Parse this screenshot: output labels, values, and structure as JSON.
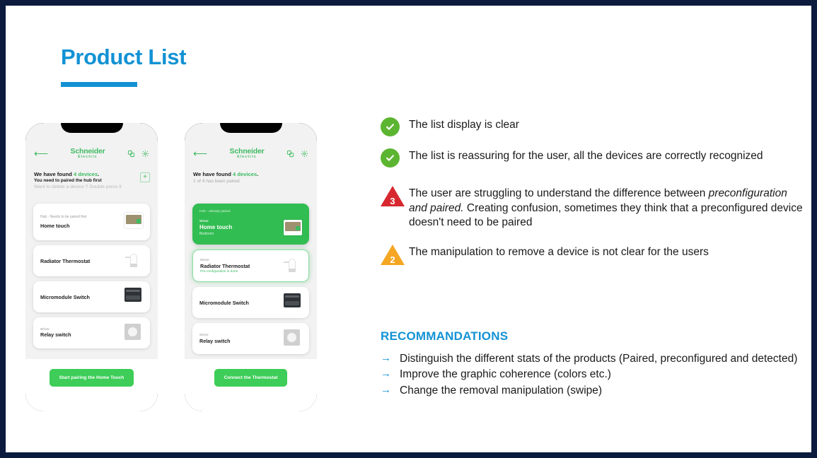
{
  "slide": {
    "title": "Product List",
    "border_color": "#0a1b3d",
    "accent_blue": "#1292d4"
  },
  "phones": [
    {
      "id": "phone-left",
      "app": {
        "back_icon": "back-arrow-icon",
        "logo_main": "Schneider",
        "logo_sub": "Electric",
        "icons": [
          "devices-icon",
          "gear-icon"
        ],
        "add_label": "+"
      },
      "found_prefix": "We have found ",
      "found_count": "4 devices",
      "found_suffix": ".",
      "found_sub": "You need to paired the hub first",
      "found_hint": "Want to delete a device ? Double press it",
      "cards": [
        {
          "status": "Hub - Needs to be paired first",
          "eyebrow": "",
          "name": "Home touch",
          "note": "",
          "room": "",
          "thumb": "home-touch-thumb",
          "state": "default",
          "tall": true
        },
        {
          "status": "",
          "eyebrow": "",
          "name": "Radiator Thermostat",
          "note": "",
          "room": "",
          "thumb": "radiator-valve-thumb",
          "state": "default",
          "tall": false
        },
        {
          "status": "",
          "eyebrow": "",
          "name": "Micromodule Switch",
          "note": "",
          "room": "",
          "thumb": "micromodule-thumb",
          "state": "default",
          "tall": false
        },
        {
          "status": "",
          "eyebrow": "Wiser",
          "name": "Relay switch",
          "note": "",
          "room": "",
          "thumb": "relay-switch-thumb",
          "state": "default",
          "tall": false
        }
      ],
      "cta": "Start pairing the Home Touch"
    },
    {
      "id": "phone-right",
      "app": {
        "back_icon": "back-arrow-icon",
        "logo_main": "Schneider",
        "logo_sub": "Electric",
        "icons": [
          "devices-icon",
          "gear-icon"
        ],
        "add_label": ""
      },
      "found_prefix": "We have found ",
      "found_count": "4 devices",
      "found_suffix": ".",
      "found_sub": "1 of 4 has been paired",
      "found_hint": "",
      "cards": [
        {
          "status": "Hub - already paired",
          "eyebrow": "Wiser",
          "name": "Home touch",
          "note": "",
          "room": "Bedroom",
          "thumb": "home-touch-thumb",
          "state": "paired",
          "tall": true
        },
        {
          "status": "",
          "eyebrow": "Wiser",
          "name": "Radiator Thermostat",
          "note": "Pre-configuration is done",
          "room": "",
          "thumb": "radiator-valve-thumb",
          "state": "preconfigured",
          "tall": false
        },
        {
          "status": "",
          "eyebrow": "",
          "name": "Micromodule Switch",
          "note": "",
          "room": "",
          "thumb": "micromodule-thumb",
          "state": "default",
          "tall": false
        },
        {
          "status": "",
          "eyebrow": "Wiser",
          "name": "Relay switch",
          "note": "",
          "room": "",
          "thumb": "relay-switch-thumb",
          "state": "default",
          "tall": false
        }
      ],
      "cta": "Connect the Thermostat"
    }
  ],
  "findings": [
    {
      "badge": "check",
      "color": "#5cb531",
      "text": "The list display is clear"
    },
    {
      "badge": "check",
      "color": "#5cb531",
      "text": "The list is reassuring for the user, all the devices are correctly recognized"
    },
    {
      "badge": "triangle",
      "number": "3",
      "color": "#d7282f",
      "text_before": "The user are struggling to understand the difference between ",
      "text_italic": "preconfiguration and paired.",
      "text_after": " Creating confusion, sometimes they think that a preconfigured device doesn't need to be paired"
    },
    {
      "badge": "triangle",
      "number": "2",
      "color": "#f5a623",
      "text": "The manipulation to remove a device is not clear for the users"
    }
  ],
  "recommendations": {
    "title": "RECOMMANDATIONS",
    "arrow": "→",
    "items": [
      "Distinguish the different stats of the products (Paired, preconfigured and detected)",
      "Improve the graphic coherence (colors etc.)",
      "Change the removal manipulation (swipe)"
    ]
  }
}
